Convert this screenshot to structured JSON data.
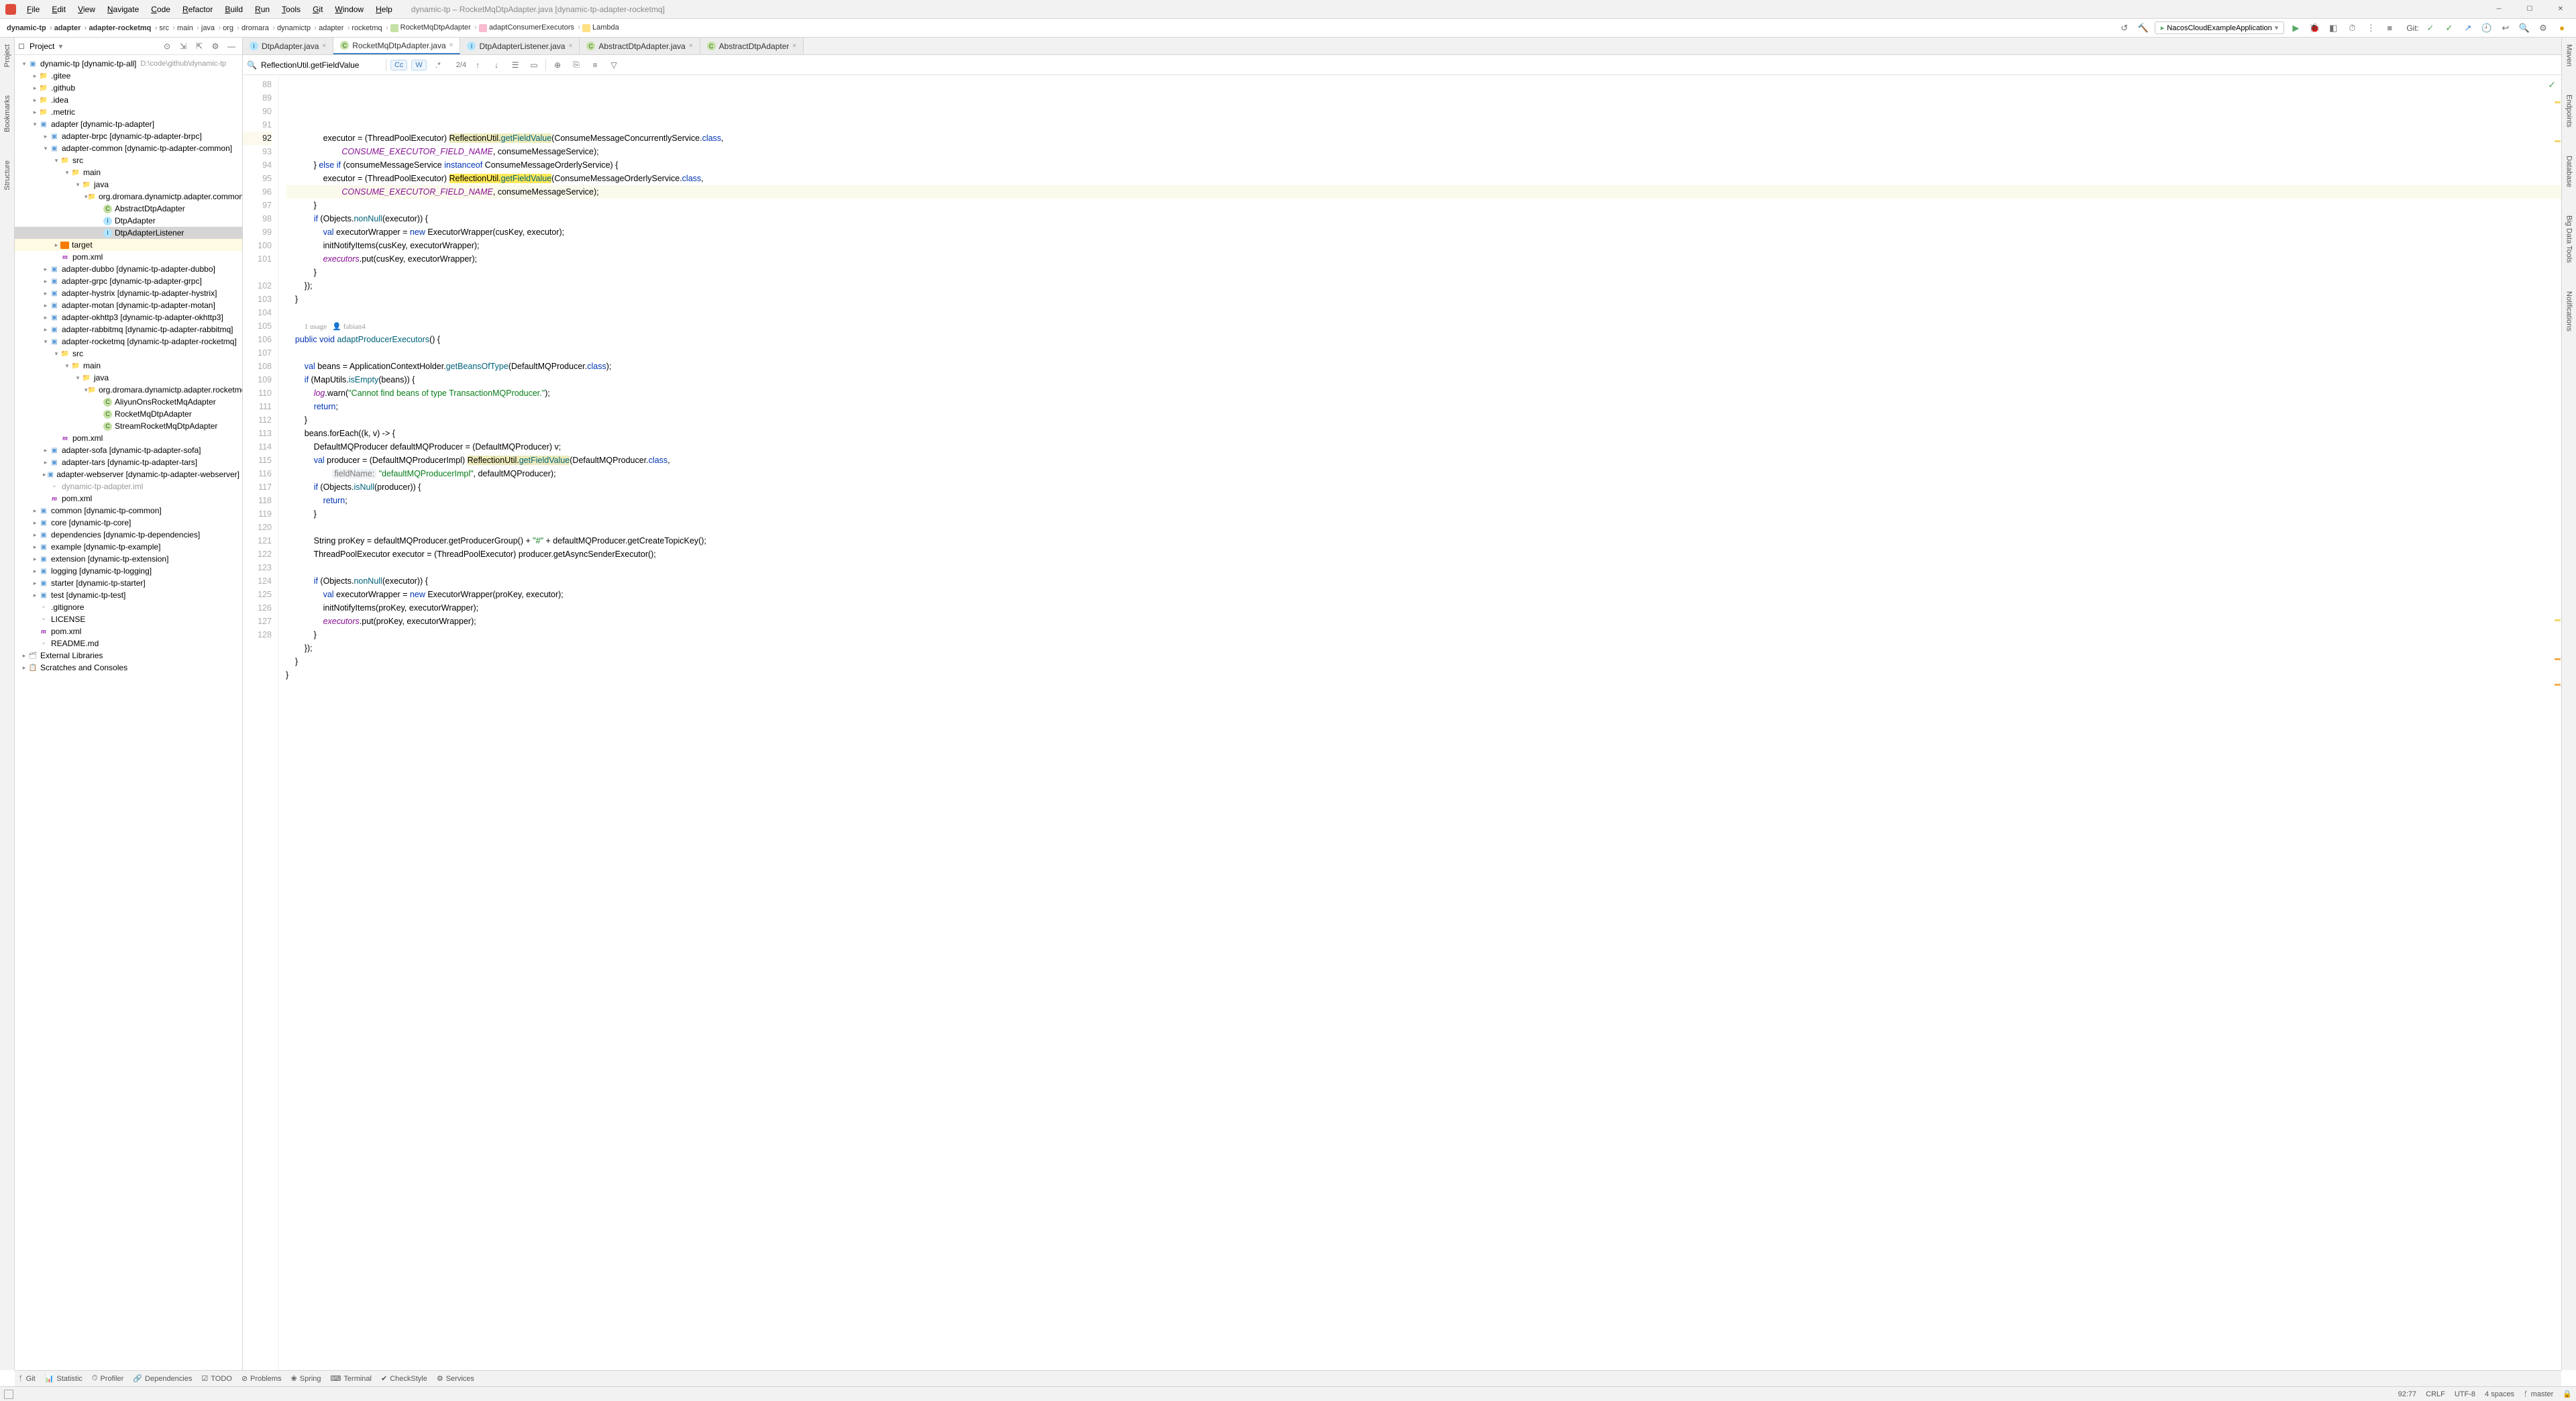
{
  "window": {
    "title": "dynamic-tp – RocketMqDtpAdapter.java [dynamic-tp-adapter-rocketmq]"
  },
  "menu": [
    "File",
    "Edit",
    "View",
    "Navigate",
    "Code",
    "Refactor",
    "Build",
    "Run",
    "Tools",
    "Git",
    "Window",
    "Help"
  ],
  "breadcrumbs": [
    {
      "label": "dynamic-tp",
      "bold": true
    },
    {
      "label": "adapter",
      "bold": true
    },
    {
      "label": "adapter-rocketmq",
      "bold": true
    },
    {
      "label": "src"
    },
    {
      "label": "main"
    },
    {
      "label": "java"
    },
    {
      "label": "org"
    },
    {
      "label": "dromara"
    },
    {
      "label": "dynamictp"
    },
    {
      "label": "adapter"
    },
    {
      "label": "rocketmq"
    },
    {
      "label": "RocketMqDtpAdapter",
      "icon": "class"
    },
    {
      "label": "adaptConsumerExecutors",
      "icon": "method"
    },
    {
      "label": "Lambda",
      "icon": "lambda"
    }
  ],
  "run_config": "NacosCloudExampleApplication",
  "git_label": "Git:",
  "project_panel": {
    "title": "Project",
    "root": {
      "label": "dynamic-tp [dynamic-tp-all]",
      "hint": "D:\\code\\github\\dynamic-tp"
    }
  },
  "tree": [
    {
      "d": 0,
      "tw": "v",
      "icon": "module",
      "label": "dynamic-tp",
      "suffix": " [dynamic-tp-all]",
      "hint": "D:\\code\\github\\dynamic-tp",
      "bold": true
    },
    {
      "d": 1,
      "tw": ">",
      "icon": "folder",
      "label": ".gitee"
    },
    {
      "d": 1,
      "tw": ">",
      "icon": "folder",
      "label": ".github"
    },
    {
      "d": 1,
      "tw": ">",
      "icon": "folder",
      "label": ".idea"
    },
    {
      "d": 1,
      "tw": ">",
      "icon": "folder",
      "label": ".metric"
    },
    {
      "d": 1,
      "tw": "v",
      "icon": "module",
      "label": "adapter",
      "suffix": " [dynamic-tp-adapter]",
      "bold": true
    },
    {
      "d": 2,
      "tw": ">",
      "icon": "module",
      "label": "adapter-brpc",
      "suffix": " [dynamic-tp-adapter-brpc]",
      "bold": true
    },
    {
      "d": 2,
      "tw": "v",
      "icon": "module",
      "label": "adapter-common",
      "suffix": " [dynamic-tp-adapter-common]",
      "bold": true
    },
    {
      "d": 3,
      "tw": "v",
      "icon": "srcfolder",
      "label": "src"
    },
    {
      "d": 4,
      "tw": "v",
      "icon": "folder",
      "label": "main"
    },
    {
      "d": 5,
      "tw": "v",
      "icon": "srcfolder",
      "label": "java"
    },
    {
      "d": 6,
      "tw": "v",
      "icon": "folder",
      "label": "org.dromara.dynamictp.adapter.common"
    },
    {
      "d": 7,
      "tw": " ",
      "icon": "java-c",
      "label": "AbstractDtpAdapter"
    },
    {
      "d": 7,
      "tw": " ",
      "icon": "java-i",
      "label": "DtpAdapter"
    },
    {
      "d": 7,
      "tw": " ",
      "icon": "java-i",
      "label": "DtpAdapterListener",
      "sel": true
    },
    {
      "d": 3,
      "tw": ">",
      "icon": "tgtfolder",
      "label": "target",
      "tgt": true
    },
    {
      "d": 3,
      "tw": " ",
      "icon": "xml",
      "label": "pom.xml"
    },
    {
      "d": 2,
      "tw": ">",
      "icon": "module",
      "label": "adapter-dubbo",
      "suffix": " [dynamic-tp-adapter-dubbo]",
      "bold": true
    },
    {
      "d": 2,
      "tw": ">",
      "icon": "module",
      "label": "adapter-grpc",
      "suffix": " [dynamic-tp-adapter-grpc]",
      "bold": true
    },
    {
      "d": 2,
      "tw": ">",
      "icon": "module",
      "label": "adapter-hystrix",
      "suffix": " [dynamic-tp-adapter-hystrix]",
      "bold": true
    },
    {
      "d": 2,
      "tw": ">",
      "icon": "module",
      "label": "adapter-motan",
      "suffix": " [dynamic-tp-adapter-motan]",
      "bold": true
    },
    {
      "d": 2,
      "tw": ">",
      "icon": "module",
      "label": "adapter-okhttp3",
      "suffix": " [dynamic-tp-adapter-okhttp3]",
      "bold": true
    },
    {
      "d": 2,
      "tw": ">",
      "icon": "module",
      "label": "adapter-rabbitmq",
      "suffix": " [dynamic-tp-adapter-rabbitmq]",
      "bold": true
    },
    {
      "d": 2,
      "tw": "v",
      "icon": "module",
      "label": "adapter-rocketmq",
      "suffix": " [dynamic-tp-adapter-rocketmq]",
      "bold": true
    },
    {
      "d": 3,
      "tw": "v",
      "icon": "srcfolder",
      "label": "src"
    },
    {
      "d": 4,
      "tw": "v",
      "icon": "folder",
      "label": "main"
    },
    {
      "d": 5,
      "tw": "v",
      "icon": "srcfolder",
      "label": "java"
    },
    {
      "d": 6,
      "tw": "v",
      "icon": "folder",
      "label": "org.dromara.dynamictp.adapter.rocketmq"
    },
    {
      "d": 7,
      "tw": " ",
      "icon": "java-c",
      "label": "AliyunOnsRocketMqAdapter"
    },
    {
      "d": 7,
      "tw": " ",
      "icon": "java-c",
      "label": "RocketMqDtpAdapter"
    },
    {
      "d": 7,
      "tw": " ",
      "icon": "java-c",
      "label": "StreamRocketMqDtpAdapter"
    },
    {
      "d": 3,
      "tw": " ",
      "icon": "xml",
      "label": "pom.xml"
    },
    {
      "d": 2,
      "tw": ">",
      "icon": "module",
      "label": "adapter-sofa",
      "suffix": " [dynamic-tp-adapter-sofa]",
      "bold": true
    },
    {
      "d": 2,
      "tw": ">",
      "icon": "module",
      "label": "adapter-tars",
      "suffix": " [dynamic-tp-adapter-tars]",
      "bold": true
    },
    {
      "d": 2,
      "tw": ">",
      "icon": "module",
      "label": "adapter-webserver",
      "suffix": " [dynamic-tp-adapter-webserver]",
      "bold": true
    },
    {
      "d": 2,
      "tw": " ",
      "icon": "file",
      "label": "dynamic-tp-adapter.iml",
      "muted": true
    },
    {
      "d": 2,
      "tw": " ",
      "icon": "xml",
      "label": "pom.xml"
    },
    {
      "d": 1,
      "tw": ">",
      "icon": "module",
      "label": "common",
      "suffix": " [dynamic-tp-common]",
      "bold": true
    },
    {
      "d": 1,
      "tw": ">",
      "icon": "module",
      "label": "core",
      "suffix": " [dynamic-tp-core]",
      "bold": true
    },
    {
      "d": 1,
      "tw": ">",
      "icon": "module",
      "label": "dependencies",
      "suffix": " [dynamic-tp-dependencies]",
      "bold": true
    },
    {
      "d": 1,
      "tw": ">",
      "icon": "module",
      "label": "example",
      "suffix": " [dynamic-tp-example]",
      "bold": true
    },
    {
      "d": 1,
      "tw": ">",
      "icon": "module",
      "label": "extension",
      "suffix": " [dynamic-tp-extension]",
      "bold": true
    },
    {
      "d": 1,
      "tw": ">",
      "icon": "module",
      "label": "logging",
      "suffix": " [dynamic-tp-logging]",
      "bold": true
    },
    {
      "d": 1,
      "tw": ">",
      "icon": "module",
      "label": "starter",
      "suffix": " [dynamic-tp-starter]",
      "bold": true
    },
    {
      "d": 1,
      "tw": ">",
      "icon": "module",
      "label": "test",
      "suffix": " [dynamic-tp-test]",
      "bold": true
    },
    {
      "d": 1,
      "tw": " ",
      "icon": "file",
      "label": ".gitignore"
    },
    {
      "d": 1,
      "tw": " ",
      "icon": "file",
      "label": "LICENSE"
    },
    {
      "d": 1,
      "tw": " ",
      "icon": "xml",
      "label": "pom.xml"
    },
    {
      "d": 1,
      "tw": " ",
      "icon": "file",
      "label": "README.md"
    },
    {
      "d": 0,
      "tw": ">",
      "icon": "lib",
      "label": "External Libraries"
    },
    {
      "d": 0,
      "tw": ">",
      "icon": "scratch",
      "label": "Scratches and Consoles"
    }
  ],
  "tabs": [
    {
      "icon": "java-i",
      "label": "DtpAdapter.java",
      "active": false
    },
    {
      "icon": "java-c",
      "label": "RocketMqDtpAdapter.java",
      "active": true
    },
    {
      "icon": "java-i",
      "label": "DtpAdapterListener.java",
      "active": false
    },
    {
      "icon": "java-c",
      "label": "AbstractDtpAdapter.java",
      "active": false
    },
    {
      "icon": "java-c",
      "label": "AbstractDtpAdapter",
      "active": false,
      "noext": true
    }
  ],
  "find": {
    "query": "ReflectionUtil.getFieldValue",
    "match": "2/4"
  },
  "code_start_line": 88,
  "current_line": 92,
  "usage_line": {
    "usages": "1 usage",
    "author": "fabian4"
  },
  "code_lines": [
    {
      "n": 88,
      "segs": [
        {
          "t": "                executor = (ThreadPoolExecutor) "
        },
        {
          "t": "ReflectionUtil",
          "c": "hl"
        },
        {
          "t": ".",
          "c": "hl"
        },
        {
          "t": "getFieldValue",
          "c": "hl mth"
        },
        {
          "t": "(ConsumeMessageConcurrentlyService."
        },
        {
          "t": "class",
          "c": "kw"
        },
        {
          "t": ","
        }
      ]
    },
    {
      "n": 89,
      "segs": [
        {
          "t": "                        "
        },
        {
          "t": "CONSUME_EXECUTOR_FIELD_NAME",
          "c": "stat"
        },
        {
          "t": ", consumeMessageService);"
        }
      ]
    },
    {
      "n": 90,
      "segs": [
        {
          "t": "            } "
        },
        {
          "t": "else if",
          "c": "kw"
        },
        {
          "t": " (consumeMessageService "
        },
        {
          "t": "instanceof",
          "c": "kw"
        },
        {
          "t": " ConsumeMessageOrderlyService) {"
        }
      ]
    },
    {
      "n": 91,
      "segs": [
        {
          "t": "                executor = (ThreadPoolExecutor) "
        },
        {
          "t": "ReflectionUtil",
          "c": "hlcur"
        },
        {
          "t": ".",
          "c": "hlcur"
        },
        {
          "t": "getFieldValue",
          "c": "hlcur mth"
        },
        {
          "t": "(ConsumeMessageOrderlyService."
        },
        {
          "t": "class",
          "c": "kw"
        },
        {
          "t": ","
        }
      ]
    },
    {
      "n": 92,
      "cur": true,
      "segs": [
        {
          "t": "                        "
        },
        {
          "t": "CONSUME_EXECUTOR_FIELD_NAME",
          "c": "stat"
        },
        {
          "t": ", consumeMessageService);"
        }
      ]
    },
    {
      "n": 93,
      "segs": [
        {
          "t": "            }"
        }
      ]
    },
    {
      "n": 94,
      "segs": [
        {
          "t": "            "
        },
        {
          "t": "if",
          "c": "kw"
        },
        {
          "t": " (Objects."
        },
        {
          "t": "nonNull",
          "c": "mth"
        },
        {
          "t": "(executor)) {"
        }
      ]
    },
    {
      "n": 95,
      "segs": [
        {
          "t": "                "
        },
        {
          "t": "val",
          "c": "kw"
        },
        {
          "t": " executorWrapper = "
        },
        {
          "t": "new",
          "c": "kw"
        },
        {
          "t": " ExecutorWrapper(cusKey, executor);"
        }
      ]
    },
    {
      "n": 96,
      "segs": [
        {
          "t": "                initNotifyItems(cusKey, executorWrapper);"
        }
      ]
    },
    {
      "n": 97,
      "segs": [
        {
          "t": "                "
        },
        {
          "t": "executors",
          "c": "fld"
        },
        {
          "t": ".put(cusKey, executorWrapper);"
        }
      ]
    },
    {
      "n": 98,
      "segs": [
        {
          "t": "            }"
        }
      ]
    },
    {
      "n": 99,
      "segs": [
        {
          "t": "        });"
        }
      ]
    },
    {
      "n": 100,
      "segs": [
        {
          "t": "    }"
        }
      ]
    },
    {
      "n": 101,
      "segs": [
        {
          "t": ""
        }
      ]
    },
    {
      "n": -1,
      "usage": true
    },
    {
      "n": 102,
      "segs": [
        {
          "t": "    "
        },
        {
          "t": "public",
          "c": "kw"
        },
        {
          "t": " "
        },
        {
          "t": "void",
          "c": "kw"
        },
        {
          "t": " "
        },
        {
          "t": "adaptProducerExecutors",
          "c": "mth"
        },
        {
          "t": "() {"
        }
      ]
    },
    {
      "n": 103,
      "segs": [
        {
          "t": ""
        }
      ]
    },
    {
      "n": 104,
      "segs": [
        {
          "t": "        "
        },
        {
          "t": "val",
          "c": "kw"
        },
        {
          "t": " beans = ApplicationContextHolder."
        },
        {
          "t": "getBeansOfType",
          "c": "mth"
        },
        {
          "t": "(DefaultMQProducer."
        },
        {
          "t": "class",
          "c": "kw"
        },
        {
          "t": ");"
        }
      ]
    },
    {
      "n": 105,
      "segs": [
        {
          "t": "        "
        },
        {
          "t": "if",
          "c": "kw"
        },
        {
          "t": " (MapUtils."
        },
        {
          "t": "isEmpty",
          "c": "mth"
        },
        {
          "t": "(beans)) {"
        }
      ]
    },
    {
      "n": 106,
      "segs": [
        {
          "t": "            "
        },
        {
          "t": "log",
          "c": "fld"
        },
        {
          "t": ".warn("
        },
        {
          "t": "\"Cannot find beans of type TransactionMQProducer.\"",
          "c": "str"
        },
        {
          "t": ");"
        }
      ]
    },
    {
      "n": 107,
      "segs": [
        {
          "t": "            "
        },
        {
          "t": "return",
          "c": "kw"
        },
        {
          "t": ";"
        }
      ]
    },
    {
      "n": 108,
      "segs": [
        {
          "t": "        }"
        }
      ]
    },
    {
      "n": 109,
      "segs": [
        {
          "t": "        beans.forEach((k, v) -> {"
        }
      ]
    },
    {
      "n": 110,
      "segs": [
        {
          "t": "            DefaultMQProducer defaultMQProducer = (DefaultMQProducer) v;"
        }
      ]
    },
    {
      "n": 111,
      "segs": [
        {
          "t": "            "
        },
        {
          "t": "val",
          "c": "kw"
        },
        {
          "t": " producer = (DefaultMQProducerImpl) "
        },
        {
          "t": "ReflectionUtil",
          "c": "hl"
        },
        {
          "t": ".",
          "c": "hl"
        },
        {
          "t": "getFieldValue",
          "c": "hl mth"
        },
        {
          "t": "(DefaultMQProducer."
        },
        {
          "t": "class",
          "c": "kw"
        },
        {
          "t": ","
        }
      ]
    },
    {
      "n": 112,
      "segs": [
        {
          "t": "                    "
        },
        {
          "t": "fieldName:",
          "c": "hint"
        },
        {
          "t": " "
        },
        {
          "t": "\"defaultMQProducerImpl\"",
          "c": "str"
        },
        {
          "t": ", defaultMQProducer);"
        }
      ]
    },
    {
      "n": 113,
      "segs": [
        {
          "t": "            "
        },
        {
          "t": "if",
          "c": "kw"
        },
        {
          "t": " (Objects."
        },
        {
          "t": "isNull",
          "c": "mth"
        },
        {
          "t": "(producer)) {"
        }
      ]
    },
    {
      "n": 114,
      "segs": [
        {
          "t": "                "
        },
        {
          "t": "return",
          "c": "kw"
        },
        {
          "t": ";"
        }
      ]
    },
    {
      "n": 115,
      "segs": [
        {
          "t": "            }"
        }
      ]
    },
    {
      "n": 116,
      "segs": [
        {
          "t": ""
        }
      ]
    },
    {
      "n": 117,
      "segs": [
        {
          "t": "            String proKey = defaultMQProducer.getProducerGroup() + "
        },
        {
          "t": "\"#\"",
          "c": "str"
        },
        {
          "t": " + defaultMQProducer.getCreateTopicKey();"
        }
      ]
    },
    {
      "n": 118,
      "segs": [
        {
          "t": "            ThreadPoolExecutor executor = (ThreadPoolExecutor) producer.getAsyncSenderExecutor();"
        }
      ]
    },
    {
      "n": 119,
      "segs": [
        {
          "t": ""
        }
      ]
    },
    {
      "n": 120,
      "segs": [
        {
          "t": "            "
        },
        {
          "t": "if",
          "c": "kw"
        },
        {
          "t": " (Objects."
        },
        {
          "t": "nonNull",
          "c": "mth"
        },
        {
          "t": "(executor)) {"
        }
      ]
    },
    {
      "n": 121,
      "segs": [
        {
          "t": "                "
        },
        {
          "t": "val",
          "c": "kw"
        },
        {
          "t": " executorWrapper = "
        },
        {
          "t": "new",
          "c": "kw"
        },
        {
          "t": " ExecutorWrapper(proKey, executor);"
        }
      ]
    },
    {
      "n": 122,
      "segs": [
        {
          "t": "                initNotifyItems(proKey, executorWrapper);"
        }
      ]
    },
    {
      "n": 123,
      "segs": [
        {
          "t": "                "
        },
        {
          "t": "executors",
          "c": "fld"
        },
        {
          "t": ".put(proKey, executorWrapper);"
        }
      ]
    },
    {
      "n": 124,
      "segs": [
        {
          "t": "            }"
        }
      ]
    },
    {
      "n": 125,
      "segs": [
        {
          "t": "        });"
        }
      ]
    },
    {
      "n": 126,
      "segs": [
        {
          "t": "    }"
        }
      ]
    },
    {
      "n": 127,
      "segs": [
        {
          "t": "}"
        }
      ]
    },
    {
      "n": 128,
      "segs": [
        {
          "t": ""
        }
      ]
    }
  ],
  "left_tabs": [
    "Project",
    "Bookmarks",
    "Structure"
  ],
  "right_tabs": [
    "Maven",
    "Endpoints",
    "Database",
    "Big Data Tools",
    "Notifications"
  ],
  "bottom_tools": [
    "Git",
    "Statistic",
    "Profiler",
    "Dependencies",
    "TODO",
    "Problems",
    "Spring",
    "Terminal",
    "CheckStyle",
    "Services"
  ],
  "status": {
    "pos": "92:77",
    "eol": "CRLF",
    "enc": "UTF-8",
    "indent": "4 spaces",
    "branch": "master"
  }
}
